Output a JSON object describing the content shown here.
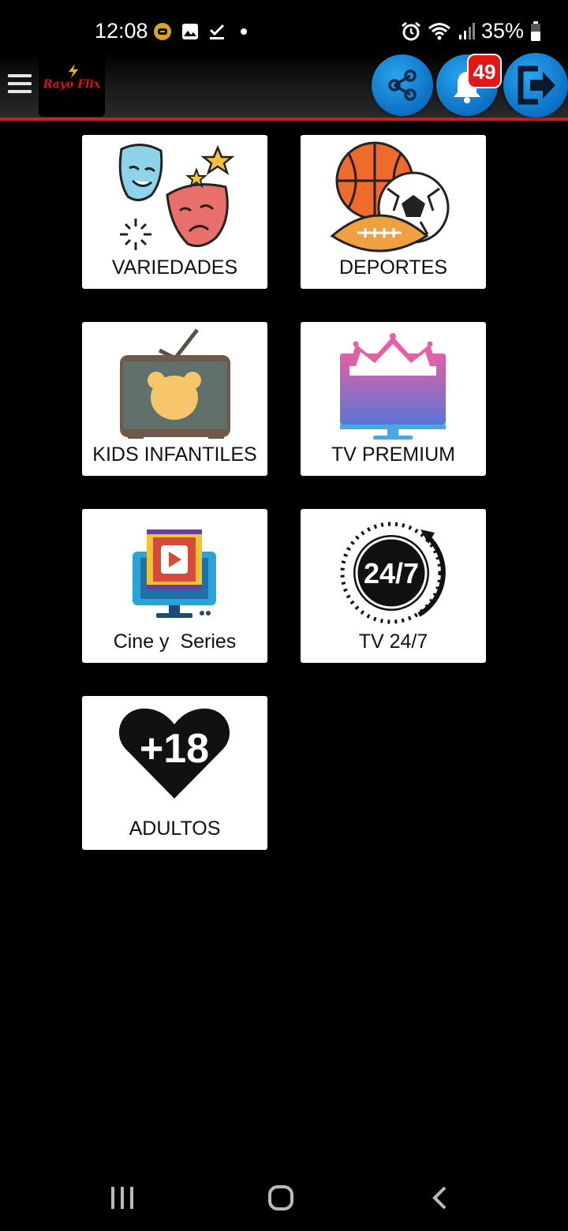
{
  "status_bar": {
    "time": "12:08",
    "battery": "35%",
    "left_icons": [
      "bixby-icon",
      "gallery-icon",
      "check-icon",
      "dot-icon"
    ],
    "right_icons": [
      "alarm-icon",
      "wifi-icon",
      "signal-icon",
      "battery-icon"
    ]
  },
  "app_bar": {
    "logo_text": "Rayo Flix",
    "notification_count": "49",
    "actions": [
      "share-icon",
      "bell-icon",
      "logout-icon"
    ],
    "accent_color": "#d31c1c",
    "button_color": "#0b70c4"
  },
  "categories": [
    {
      "label": "VARIEDADES",
      "icon": "theater-masks-icon"
    },
    {
      "label": "DEPORTES",
      "icon": "sports-balls-icon"
    },
    {
      "label": "KIDS INFANTILES",
      "icon": "kids-tv-icon"
    },
    {
      "label": "TV PREMIUM",
      "icon": "premium-tv-icon"
    },
    {
      "label": "Cine y  Series",
      "icon": "cinema-screen-icon"
    },
    {
      "label": "TV 24/7",
      "icon": "twenty-four-seven-icon"
    },
    {
      "label": "ADULTOS",
      "icon": "plus-18-heart-icon"
    }
  ],
  "icon_text": {
    "tv247": "24/7",
    "adult": "+18"
  },
  "nav_bar": [
    "recents-icon",
    "home-icon",
    "back-icon"
  ]
}
